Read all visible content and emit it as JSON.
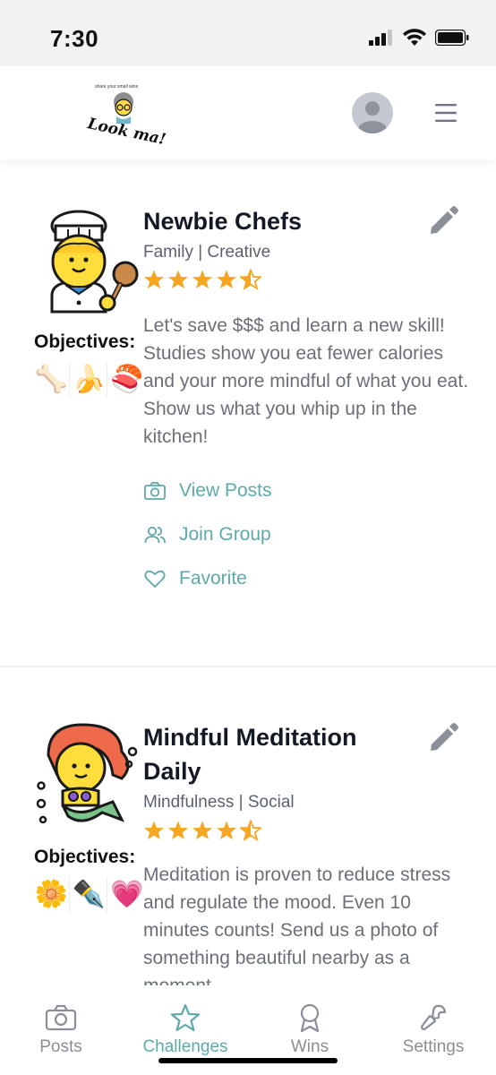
{
  "status_bar": {
    "time": "7:30"
  },
  "header": {
    "logo_text": "Look ma!",
    "logo_tagline": "share your small wins"
  },
  "cards": [
    {
      "title": "Newbie Chefs",
      "tags": "Family | Creative",
      "rating": 4.5,
      "objectives_label": "Objectives:",
      "objectives": [
        "🦴",
        "🍌",
        "🍣"
      ],
      "description": "Let's save $$$ and learn a new skill!  Studies show you eat fewer calories and your more mindful of what you eat.  Show us what you whip up in the kitchen!",
      "actions": {
        "view_posts": "View Posts",
        "join_group": "Join Group",
        "favorite": "Favorite"
      },
      "icons": {
        "illustration": "chef-icon",
        "edit": "pencil-icon"
      }
    },
    {
      "title": "Mindful Meditation Daily",
      "tags": "Mindfulness | Social",
      "rating": 4.5,
      "objectives_label": "Objectives:",
      "objectives": [
        "🌼",
        "✒️",
        "💗"
      ],
      "description": "Meditation is proven to reduce stress and regulate the mood.  Even 10 minutes counts!  Send us a photo of something beautiful nearby as a moment",
      "icons": {
        "illustration": "mermaid-icon",
        "edit": "pencil-icon"
      }
    }
  ],
  "tabs": [
    {
      "label": "Posts",
      "icon": "camera-icon",
      "active": false
    },
    {
      "label": "Challenges",
      "icon": "star-icon",
      "active": true
    },
    {
      "label": "Wins",
      "icon": "award-icon",
      "active": false
    },
    {
      "label": "Settings",
      "icon": "wrench-icon",
      "active": false
    }
  ],
  "colors": {
    "accent": "#5fa9a8",
    "star": "#f5a623",
    "title": "#141926",
    "muted_text": "#6b6f78",
    "tab_inactive": "#8a8e96"
  }
}
